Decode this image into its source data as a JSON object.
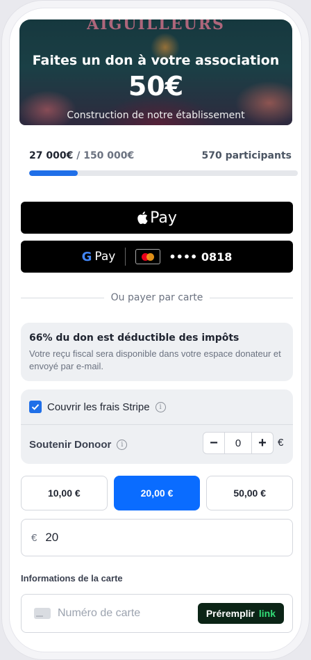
{
  "hero": {
    "brand": "AIGUILLEURS",
    "title": "Faites un don à votre association",
    "amount": "50€",
    "subtitle": "Construction de notre établissement"
  },
  "progress": {
    "raised": "27 000€",
    "separator": " / ",
    "goal": "150 000€",
    "participants": "570 participants",
    "fraction": 0.18
  },
  "payment": {
    "apple_pay_label": "Pay",
    "google_pay_label": "Pay",
    "card_last_digits": "•••• 0818"
  },
  "divider_text": "Ou payer par carte",
  "tax": {
    "title": "66% du don est déductible des impôts",
    "description": "Votre reçu fiscal sera disponible dans votre espace donateur et envoyé par e-mail."
  },
  "options": {
    "cover_fees_label": "Couvrir les frais Stripe",
    "cover_fees_checked": true,
    "support_label": "Soutenir Donoor",
    "support_value": "0",
    "minus": "−",
    "plus": "+",
    "currency": "€"
  },
  "amounts": {
    "options": [
      "10,00 €",
      "20,00 €",
      "50,00 €"
    ],
    "selected_index": 1
  },
  "custom_amount": {
    "currency": "€",
    "value": "20"
  },
  "card": {
    "section_label": "Informations de la carte",
    "number_placeholder": "Numéro de carte",
    "prefill_label": "Préremplir",
    "prefill_link": "link"
  },
  "colors": {
    "accent": "#0a6cff",
    "progress": "#1f6fe8",
    "link_green": "#33dd77"
  }
}
